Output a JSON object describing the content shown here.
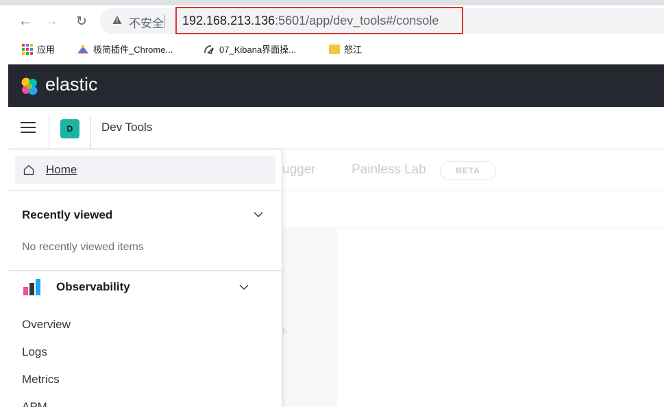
{
  "browser": {
    "security_label": "不安全",
    "url_host": "192.168.213.136",
    "url_path": ":5601/app/dev_tools#/console",
    "bookmarks": [
      {
        "label": "应用",
        "icon": "apps-grid-icon"
      },
      {
        "label": "极简插件_Chrome...",
        "icon": "extension-site-icon"
      },
      {
        "label": "07_Kibana界面操...",
        "icon": "site-icon"
      },
      {
        "label": "怒江",
        "icon": "folder-icon"
      }
    ]
  },
  "header": {
    "brand": "elastic",
    "space_initial": "D",
    "breadcrumb": "Dev Tools"
  },
  "background": {
    "tab_fragment": "ugger",
    "tab_painless": "Painless Lab",
    "beta_badge": "BETA",
    "text_fragment": "h"
  },
  "nav": {
    "home": "Home",
    "recently_viewed": {
      "title": "Recently viewed",
      "empty": "No recently viewed items"
    },
    "observability": {
      "title": "Observability",
      "items": [
        "Overview",
        "Logs",
        "Metrics",
        "APM"
      ]
    }
  },
  "colors": {
    "header_bg": "#25282f",
    "space_avatar": "#1bb4a3",
    "highlight_border": "#e0312e"
  }
}
